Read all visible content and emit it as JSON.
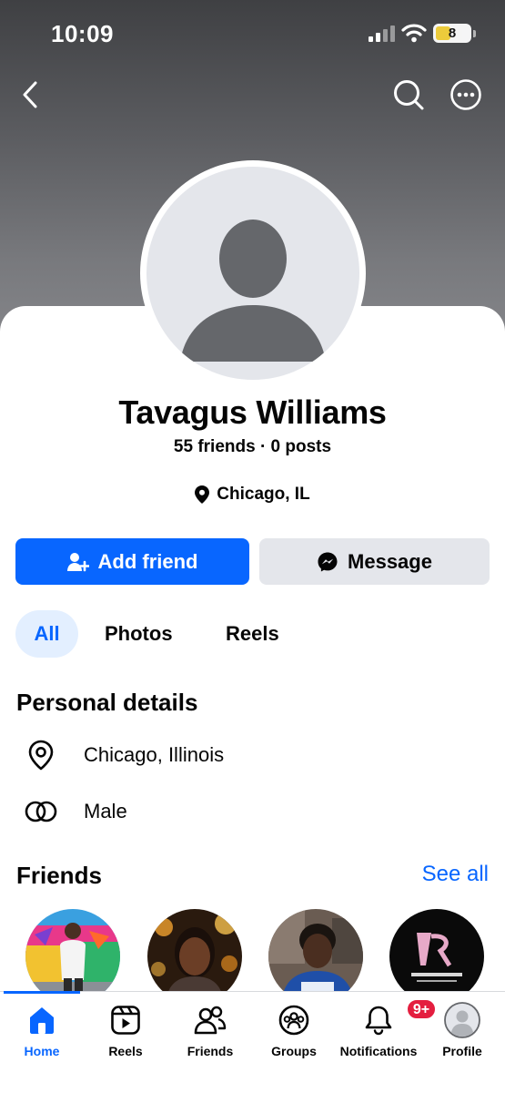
{
  "status_bar": {
    "time": "10:09",
    "battery": "8"
  },
  "profile": {
    "name": "Tavagus Williams",
    "stats": "55 friends · 0 posts",
    "location": "Chicago, IL"
  },
  "actions": {
    "add_friend": "Add friend",
    "message": "Message"
  },
  "tabs": [
    {
      "label": "All",
      "active": true
    },
    {
      "label": "Photos",
      "active": false
    },
    {
      "label": "Reels",
      "active": false
    }
  ],
  "personal_details": {
    "title": "Personal details",
    "items": [
      {
        "icon": "location-pin-icon",
        "text": "Chicago, Illinois"
      },
      {
        "icon": "gender-rings-icon",
        "text": "Male"
      }
    ]
  },
  "friends": {
    "title": "Friends",
    "see_all": "See all"
  },
  "bottom_nav": {
    "items": [
      {
        "label": "Home",
        "icon": "home-icon",
        "active": true
      },
      {
        "label": "Reels",
        "icon": "reels-icon"
      },
      {
        "label": "Friends",
        "icon": "friends-icon"
      },
      {
        "label": "Groups",
        "icon": "groups-icon"
      },
      {
        "label": "Notifications",
        "icon": "bell-icon",
        "badge": "9+"
      },
      {
        "label": "Profile",
        "icon": "profile-avatar-icon"
      }
    ]
  },
  "colors": {
    "accent": "#0866ff",
    "badge": "#e41e3f",
    "secondary_button": "#e4e6eb"
  }
}
